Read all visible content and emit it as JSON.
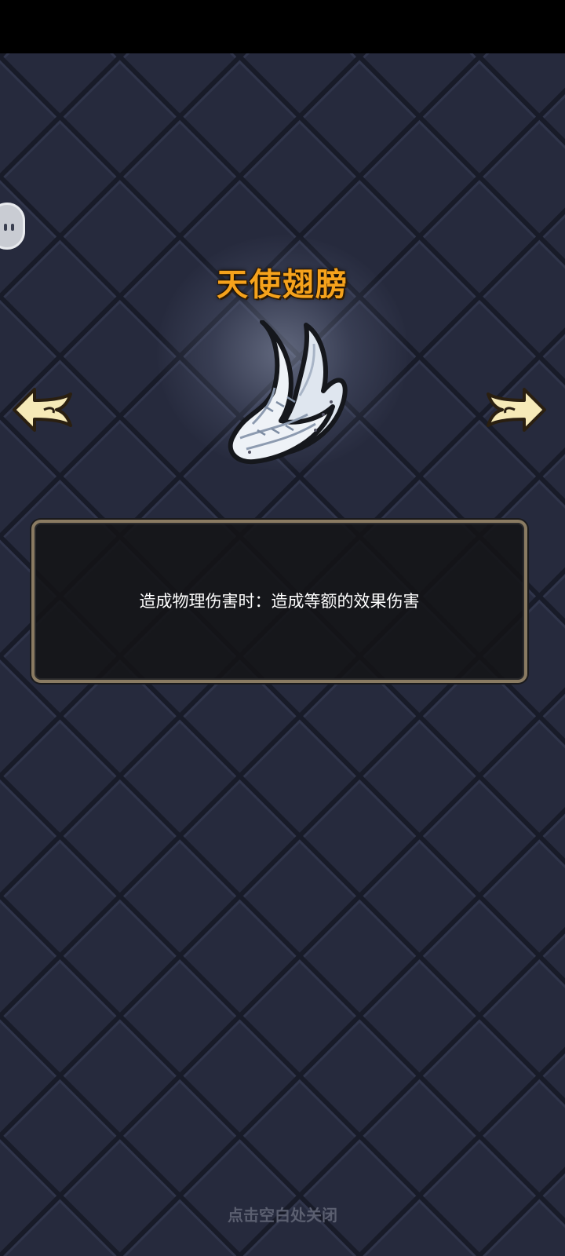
{
  "item": {
    "name": "天使翅膀",
    "description": "造成物理伤害时：造成等额的效果伤害",
    "icon": "angel-wings-icon"
  },
  "navigation": {
    "previous_icon": "arrow-left-icon",
    "next_icon": "arrow-right-icon"
  },
  "side_button": {
    "icon": "chat-bubble-icon"
  },
  "footer": {
    "close_hint": "点击空白处关闭"
  },
  "colors": {
    "background": "#23273a",
    "title": "#f5a21c",
    "panel_border": "#8a7b62",
    "arrow_fill": "#f6eab8"
  }
}
